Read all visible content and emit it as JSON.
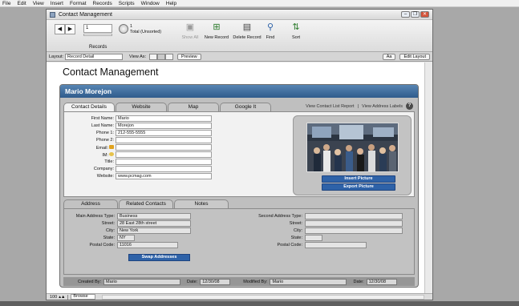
{
  "menubar": {
    "items": [
      "File",
      "Edit",
      "View",
      "Insert",
      "Format",
      "Records",
      "Scripts",
      "Window",
      "Help"
    ]
  },
  "window": {
    "title": "Contact Management",
    "controls": [
      "–",
      "❐",
      "✕"
    ]
  },
  "toolbar": {
    "record_number": "1",
    "records_label": "Records",
    "found_count": "1",
    "total_label": "Total (Unsorted)",
    "show_all": "Show All",
    "new_record": "New Record",
    "delete_record": "Delete Record",
    "find": "Find",
    "sort": "Sort"
  },
  "layout_bar": {
    "layout_label": "Layout:",
    "layout_value": "Record Detail",
    "view_as_label": "View As:",
    "preview": "Preview",
    "aa": "Aa",
    "edit_layout": "Edit Layout"
  },
  "page": {
    "title": "Contact Management",
    "contact_name": "Mario Morejon"
  },
  "tabs": [
    "Contact Details",
    "Website",
    "Map",
    "Google It"
  ],
  "links": {
    "view_list": "View Contact List Report",
    "separator": "|",
    "view_labels": "View Address Labels",
    "help": "?"
  },
  "contact": {
    "fields": [
      {
        "label": "First Name:",
        "value": "Mario"
      },
      {
        "label": "Last Name:",
        "value": "Morejon"
      },
      {
        "label": "Phone 1:",
        "value": "212-555-5555"
      },
      {
        "label": "Phone 2:",
        "value": ""
      },
      {
        "label": "Email:",
        "value": ""
      },
      {
        "label": "IM:",
        "value": ""
      },
      {
        "label": "Title:",
        "value": ""
      },
      {
        "label": "Company:",
        "value": ""
      },
      {
        "label": "Website:",
        "value": "www.pcmag.com"
      }
    ]
  },
  "picture": {
    "insert": "Insert Picture",
    "export": "Export Picture"
  },
  "address_tabs": [
    "Address",
    "Related Contacts",
    "Notes"
  ],
  "address": {
    "left": [
      {
        "label": "Main Address Type:",
        "value": "Business"
      },
      {
        "label": "Street:",
        "value": "28 East 28th street"
      },
      {
        "label": "City:",
        "value": "New York"
      },
      {
        "label": "State:",
        "value": "NY"
      },
      {
        "label": "Postal Code:",
        "value": "11016"
      }
    ],
    "right": [
      {
        "label": "Second Address Type:",
        "value": ""
      },
      {
        "label": "Street:",
        "value": ""
      },
      {
        "label": "City:",
        "value": ""
      },
      {
        "label": "State:",
        "value": ""
      },
      {
        "label": "Postal Code:",
        "value": ""
      }
    ],
    "swap": "Swap Addresses"
  },
  "footer": {
    "created_by_label": "Created By:",
    "created_by": "Mario",
    "date_label": "Date:",
    "created_date": "12/30/08",
    "modified_by_label": "Modified By:",
    "modified_by": "Mario",
    "modified_date": "12/30/08"
  },
  "status": {
    "zoom": "100",
    "mode": "Browse"
  },
  "colors": {
    "header_blue": "#2f5b8c",
    "button_blue": "#2e62a8"
  }
}
